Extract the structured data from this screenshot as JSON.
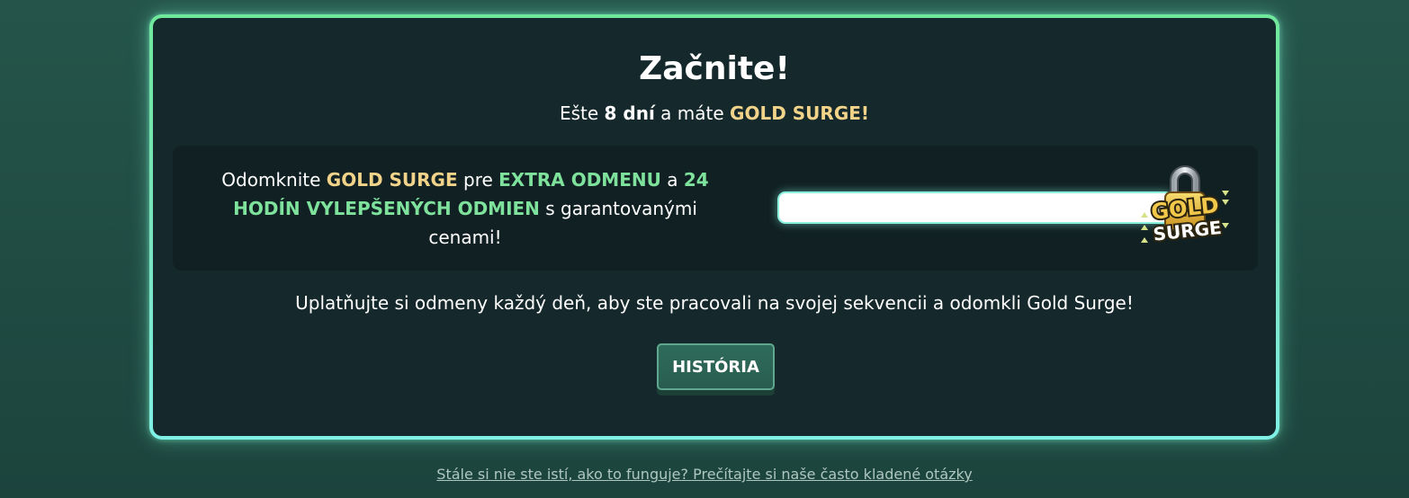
{
  "header": {
    "title": "Začnite!",
    "subtitle_prefix": "Ešte ",
    "subtitle_days": "8 dní",
    "subtitle_middle": " a máte ",
    "subtitle_highlight": "GOLD SURGE!"
  },
  "panel": {
    "text_part1": "Odomknite ",
    "text_gold": "GOLD SURGE",
    "text_part2": " pre ",
    "text_extra": "EXTRA ODMENU",
    "text_part3": " a ",
    "text_hours": "24 HODÍN VYLEPŠENÝCH ODMIEN",
    "text_part4": " s garantovanými cenami!",
    "progress": 0,
    "badge_line1": "GOLD",
    "badge_line2": "SURGE",
    "badge_icon": "padlock-icon"
  },
  "info_text": "Uplatňujte si odmeny každý deň, aby ste pracovali na svojej sekvencii a odomkli Gold Surge!",
  "history_button": "HISTÓRIA",
  "faq_link": "Stále si nie ste istí, ako to funguje? Prečítajte si naše často kladené otázky",
  "colors": {
    "gold": "#f2d38a",
    "green": "#7ee29c",
    "card_bg": "#15282b",
    "border": "#7ae3c1"
  }
}
